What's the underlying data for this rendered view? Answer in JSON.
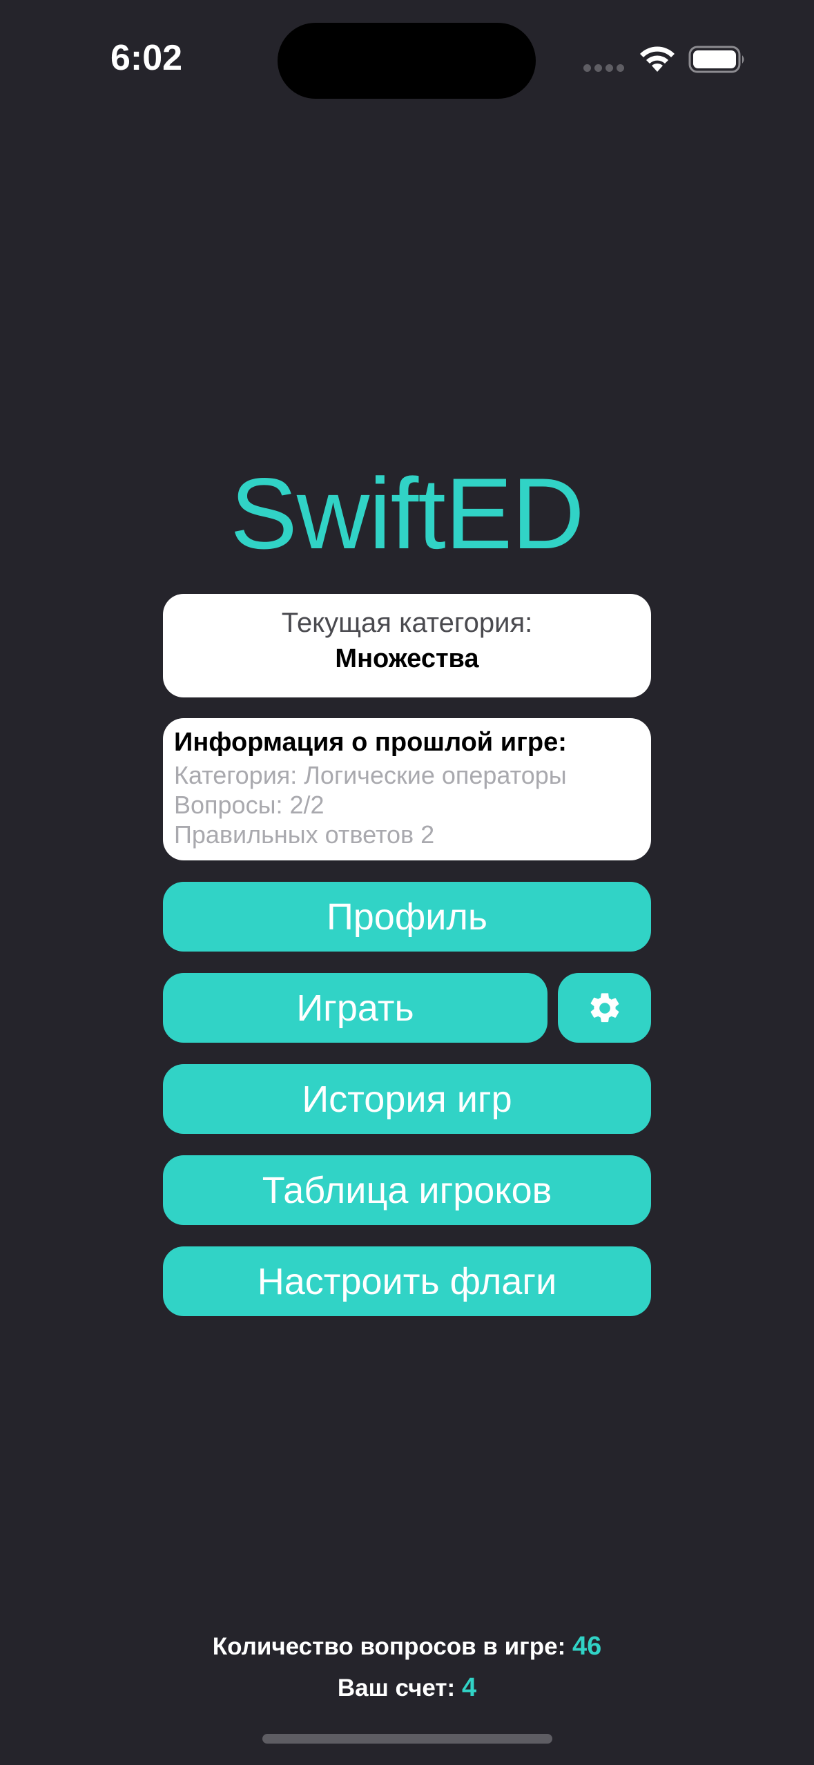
{
  "status_bar": {
    "time": "6:02"
  },
  "app": {
    "title": "SwiftED"
  },
  "current_category": {
    "label": "Текущая категория:",
    "value": "Множества"
  },
  "last_game": {
    "title": "Информация о прошлой игре:",
    "category": "Категория: Логические операторы",
    "questions": "Вопросы: 2/2",
    "correct_answers": "Правильных ответов 2"
  },
  "buttons": {
    "profile": "Профиль",
    "play": "Играть",
    "settings_icon": "gear-icon",
    "history": "История игр",
    "leaderboard": "Таблица игроков",
    "flags": "Настроить флаги"
  },
  "footer": {
    "questions_label": "Количество вопросов в игре:",
    "questions_value": "46",
    "score_label": "Ваш счет:",
    "score_value": "4"
  },
  "colors": {
    "background": "#25242b",
    "accent": "#31d3c6",
    "card": "#ffffff"
  }
}
